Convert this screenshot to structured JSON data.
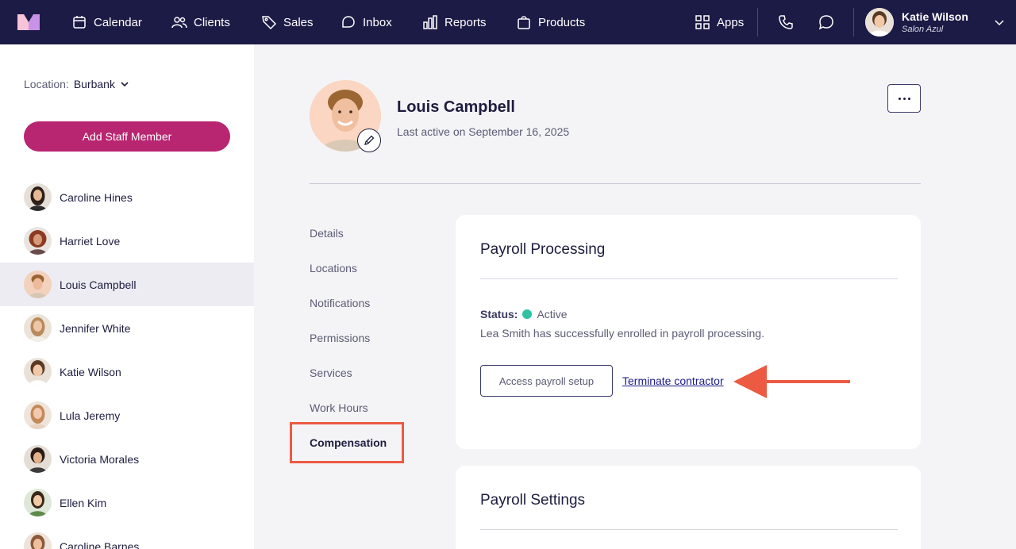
{
  "nav": {
    "items": [
      "Calendar",
      "Clients",
      "Sales",
      "Inbox",
      "Reports",
      "Products"
    ],
    "apps_label": "Apps",
    "user_name": "Katie Wilson",
    "user_salon": "Salon Azul"
  },
  "sidebar": {
    "location_label": "Location:",
    "location_value": "Burbank",
    "add_staff_label": "Add Staff Member",
    "staff": [
      "Caroline Hines",
      "Harriet Love",
      "Louis Campbell",
      "Jennifer White",
      "Katie Wilson",
      "Lula Jeremy",
      "Victoria Morales",
      "Ellen Kim",
      "Caroline Barnes"
    ],
    "active_index": 2
  },
  "profile": {
    "name": "Louis Campbell",
    "last_active": "Last active on September 16, 2025"
  },
  "subnav": {
    "items": [
      "Details",
      "Locations",
      "Notifications",
      "Permissions",
      "Services",
      "Work Hours"
    ],
    "active": "Compensation"
  },
  "payroll": {
    "title": "Payroll Processing",
    "status_label": "Status:",
    "status_value": "Active",
    "message": "Lea Smith has successfully enrolled in payroll processing.",
    "access_button": "Access payroll setup",
    "terminate_link": "Terminate contractor"
  },
  "settings": {
    "title": "Payroll Settings"
  },
  "colors": {
    "nav_bg": "#1c1b46",
    "brand": "#b82570",
    "highlight": "#ec5a44",
    "status_active": "#2fc3a0"
  }
}
